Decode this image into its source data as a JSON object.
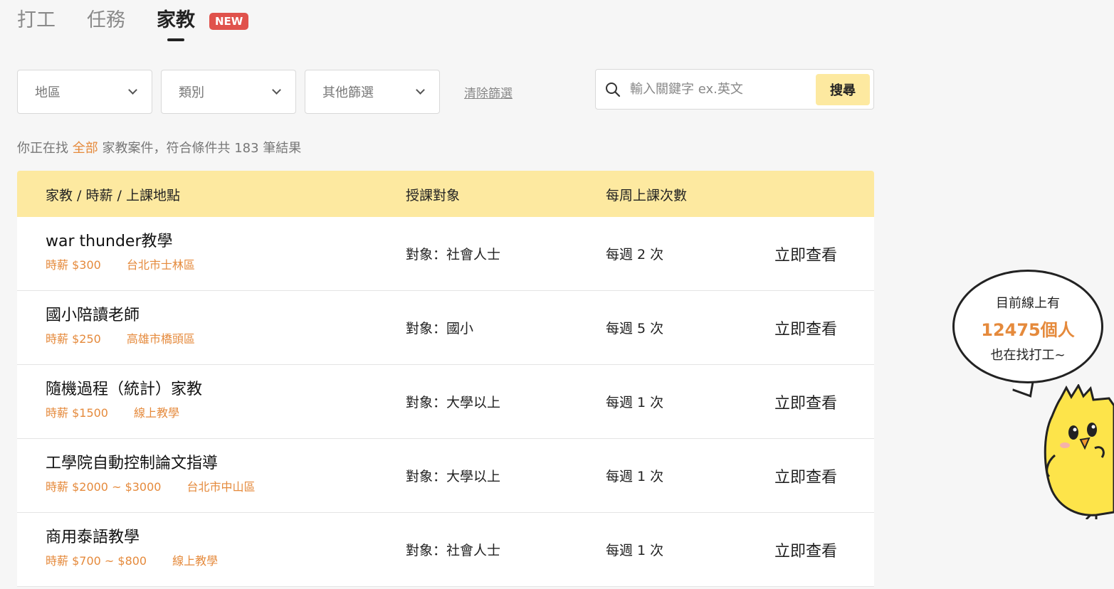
{
  "tabs": [
    {
      "label": "打工",
      "active": false
    },
    {
      "label": "任務",
      "active": false
    },
    {
      "label": "家教",
      "active": true
    }
  ],
  "new_badge": "NEW",
  "filters": {
    "region": "地區",
    "category": "類別",
    "other": "其他篩選",
    "clear": "清除篩選"
  },
  "search": {
    "placeholder": "輸入關鍵字 ex.英文",
    "button": "搜尋"
  },
  "summary": {
    "prefix": "你正在找",
    "highlight": "全部",
    "suffix": "家教案件，符合條件共 183 筆結果"
  },
  "table": {
    "headers": [
      "家教 / 時薪 / 上課地點",
      "授課對象",
      "每周上課次數"
    ],
    "rows": [
      {
        "title": "war thunder教學",
        "wage": "時薪 $300",
        "location": "台北市士林區",
        "target": "對象：社會人士",
        "frequency": "每週 2 次",
        "action": "立即查看"
      },
      {
        "title": "國小陪讀老師",
        "wage": "時薪 $250",
        "location": "高雄市橋頭區",
        "target": "對象：國小",
        "frequency": "每週 5 次",
        "action": "立即查看"
      },
      {
        "title": "隨機過程（統計）家教",
        "wage": "時薪 $1500",
        "location": "線上教學",
        "target": "對象：大學以上",
        "frequency": "每週 1 次",
        "action": "立即查看"
      },
      {
        "title": "工學院自動控制論文指導",
        "wage": "時薪 $2000 ~ $3000",
        "location": "台北市中山區",
        "target": "對象：大學以上",
        "frequency": "每週 1 次",
        "action": "立即查看"
      },
      {
        "title": "商用泰語教學",
        "wage": "時薪 $700 ~ $800",
        "location": "線上教學",
        "target": "對象：社會人士",
        "frequency": "每週 1 次",
        "action": "立即查看"
      }
    ]
  },
  "bubble": {
    "line1": "目前線上有",
    "count": "12475個人",
    "line3": "也在找打工~"
  },
  "colors": {
    "accent": "#e58a3c",
    "header_bg": "#fde9a0",
    "badge": "#e0524c"
  }
}
